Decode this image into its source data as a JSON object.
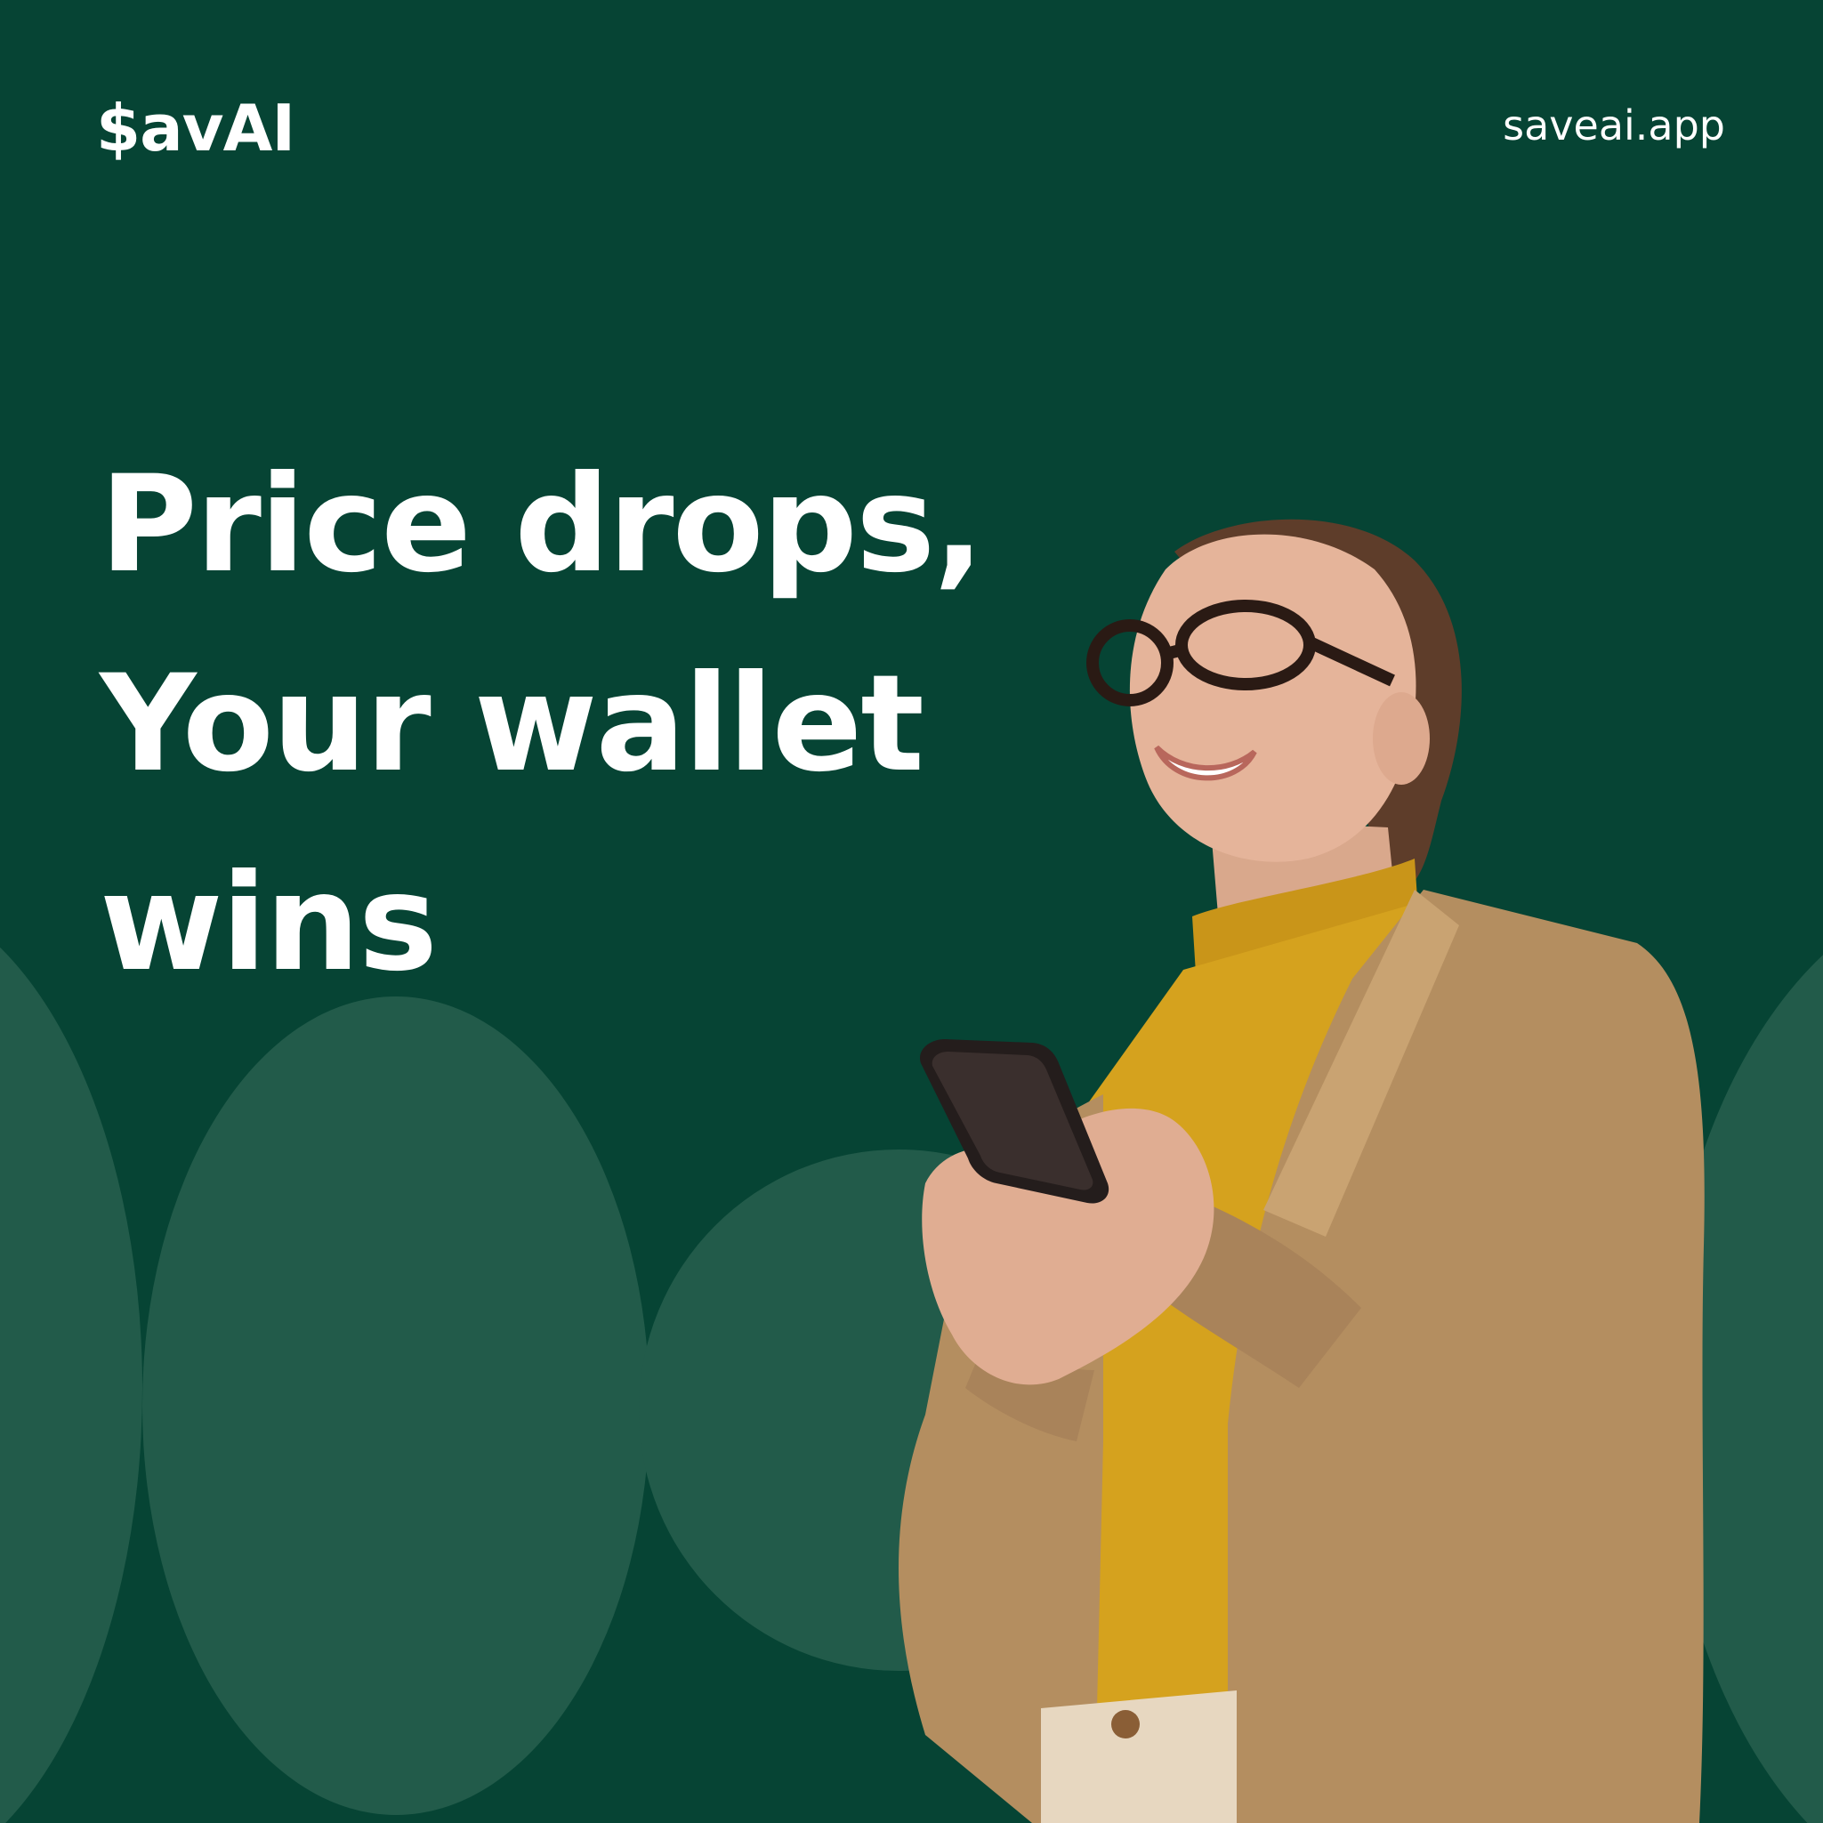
{
  "brand": {
    "logo_text": "$avAI",
    "website": "saveai.app"
  },
  "headline": {
    "line1": "Price drops,",
    "line2": "Your wallet",
    "line3": "wins"
  },
  "colors": {
    "background": "#064434",
    "shape": "#225B4A",
    "text": "#ffffff",
    "jacket": "#B48E60",
    "sweater": "#D5A21E",
    "skin": "#E5B49A",
    "hair": "#5E3D2A"
  },
  "icons": {
    "phone": "smartphone-icon"
  }
}
